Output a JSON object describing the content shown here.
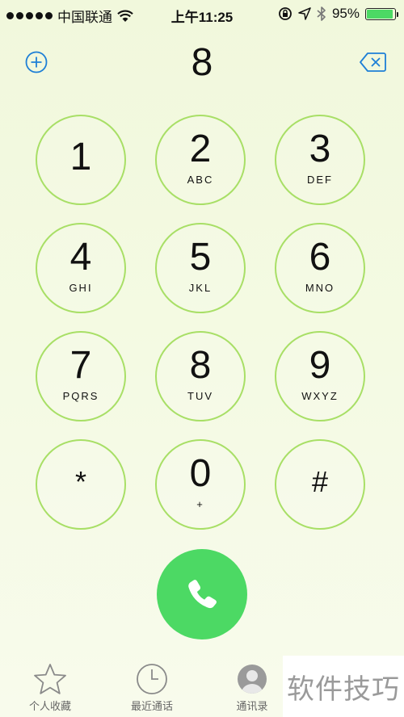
{
  "status_bar": {
    "carrier": "中国联通",
    "time": "上午11:25",
    "battery_percent": "95%",
    "battery_level": 0.95
  },
  "dialer": {
    "number": "8",
    "keys": [
      {
        "digit": "1",
        "letters": ""
      },
      {
        "digit": "2",
        "letters": "ABC"
      },
      {
        "digit": "3",
        "letters": "DEF"
      },
      {
        "digit": "4",
        "letters": "GHI"
      },
      {
        "digit": "5",
        "letters": "JKL"
      },
      {
        "digit": "6",
        "letters": "MNO"
      },
      {
        "digit": "7",
        "letters": "PQRS"
      },
      {
        "digit": "8",
        "letters": "TUV"
      },
      {
        "digit": "9",
        "letters": "WXYZ"
      },
      {
        "digit": "*",
        "letters": ""
      },
      {
        "digit": "0",
        "letters": "+"
      },
      {
        "digit": "#",
        "letters": ""
      }
    ]
  },
  "tabs": [
    {
      "label": "个人收藏",
      "icon": "star-icon"
    },
    {
      "label": "最近通话",
      "icon": "clock-icon"
    },
    {
      "label": "通讯录",
      "icon": "contacts-icon"
    }
  ],
  "watermark": "软件技巧",
  "colors": {
    "accent": "#4cd964",
    "key_ring": "#a8df66",
    "link": "#1e7fd6"
  }
}
